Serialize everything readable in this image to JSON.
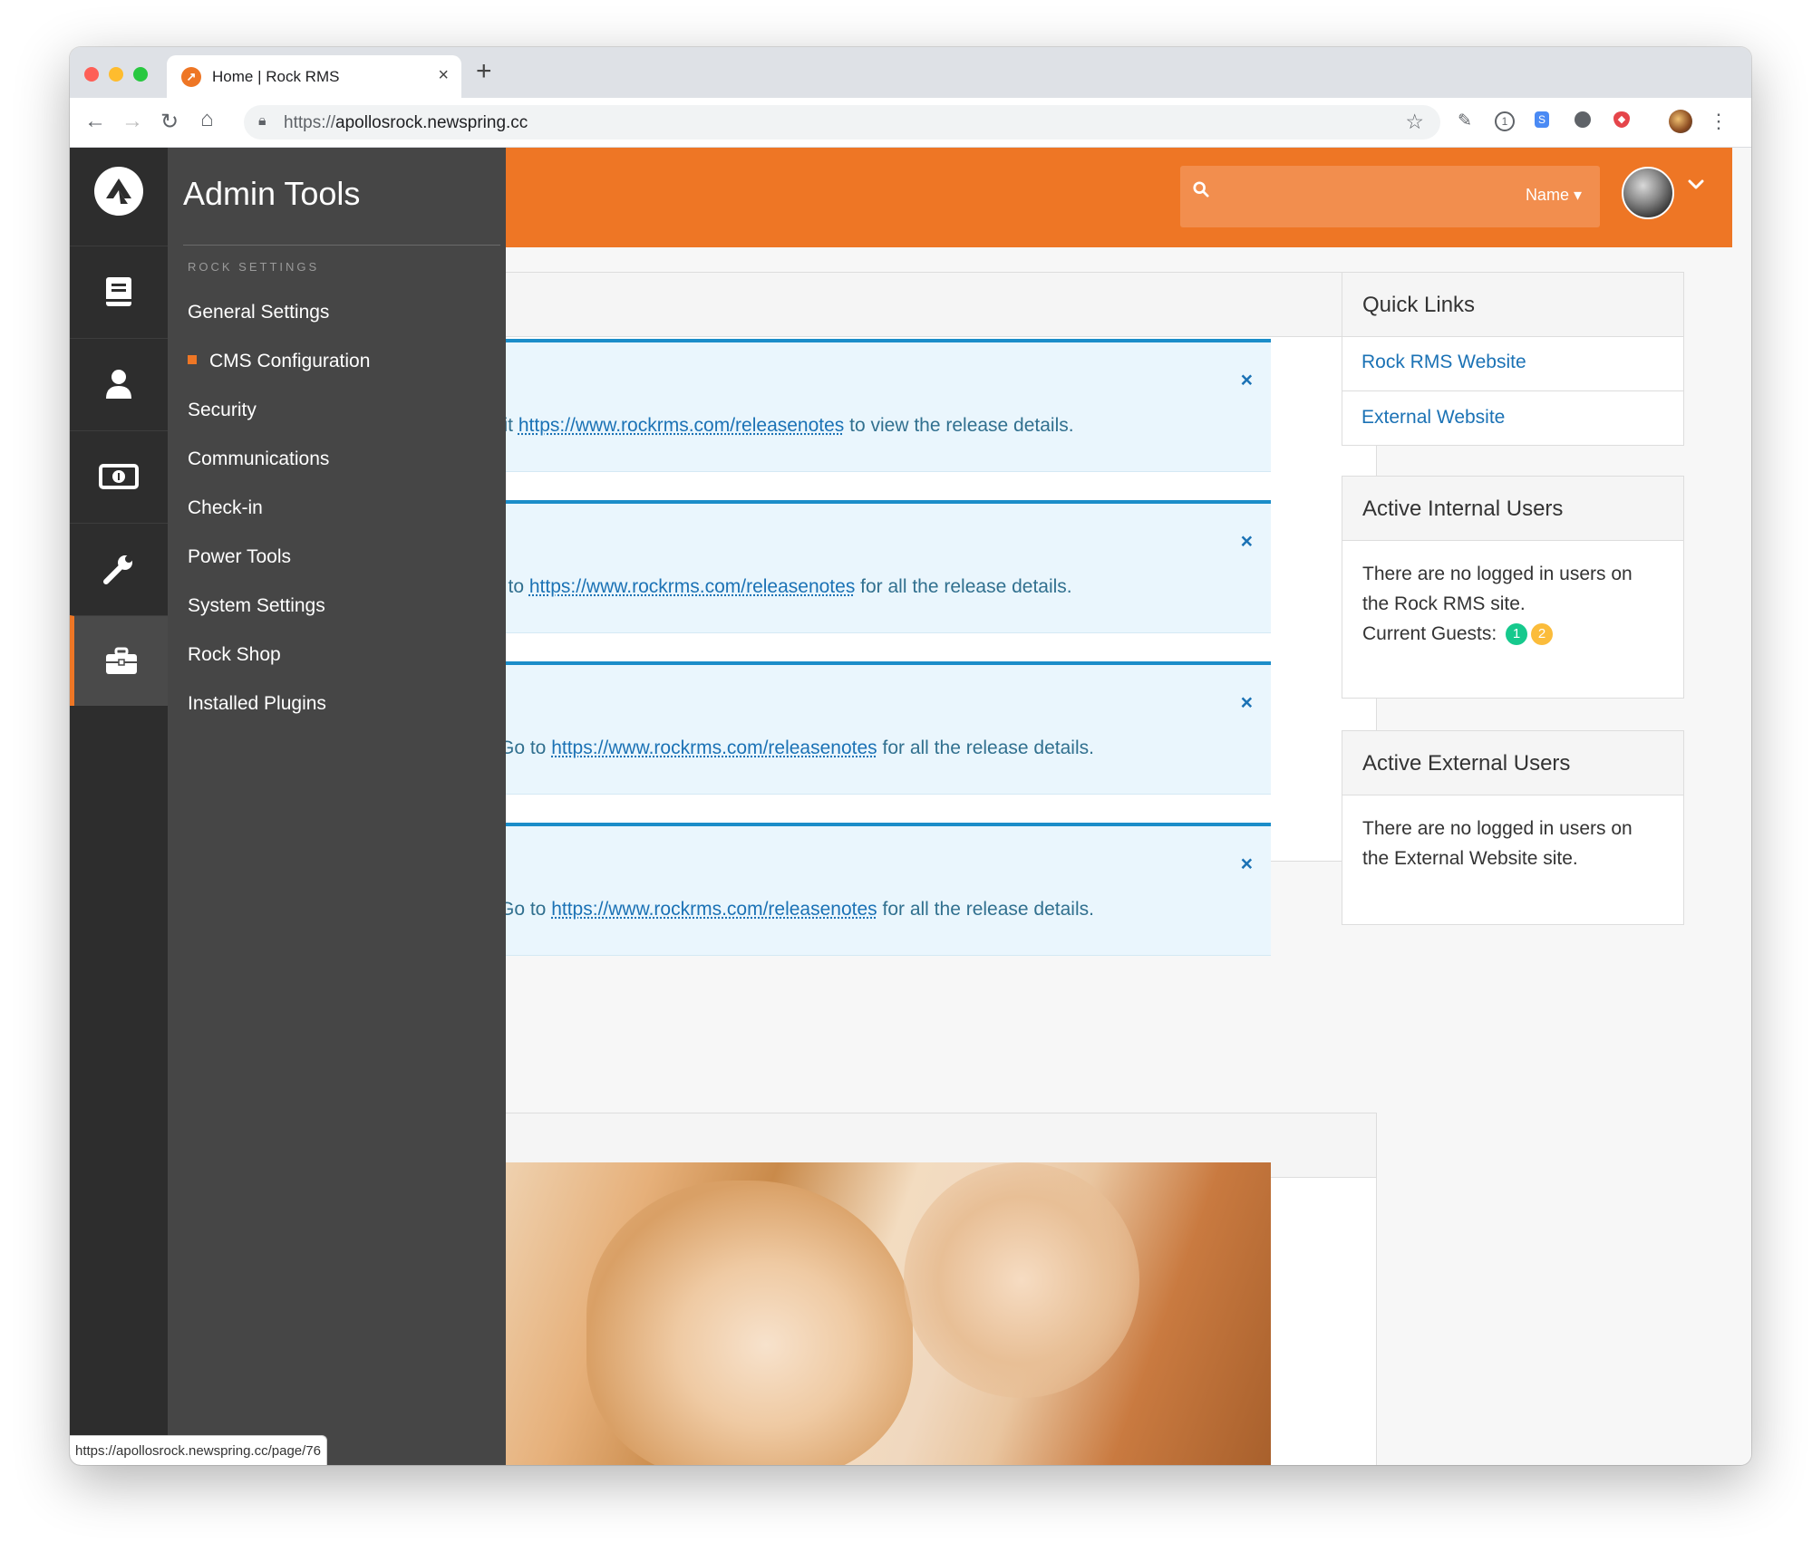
{
  "browser": {
    "tab_title": "Home | Rock RMS",
    "tab_favicon": "rock-logo-icon",
    "url_scheme": "https://",
    "url_host": "apollosrock.newspring.cc",
    "status_url": "https://apollosrock.newspring.cc/page/76"
  },
  "header": {
    "search_placeholder": "",
    "search_type_label": "Name",
    "brand_color": "#ee7625"
  },
  "sidebar": {
    "icons": [
      "book-icon",
      "person-icon",
      "money-icon",
      "wrench-icon",
      "briefcase-icon"
    ],
    "active_icon": "briefcase-icon",
    "flyout_title": "Admin Tools",
    "section_label": "ROCK SETTINGS",
    "items": [
      {
        "label": "General Settings",
        "active": false
      },
      {
        "label": "CMS Configuration",
        "active": true
      },
      {
        "label": "Security",
        "active": false
      },
      {
        "label": "Communications",
        "active": false
      },
      {
        "label": "Check-in",
        "active": false
      },
      {
        "label": "Power Tools",
        "active": false
      },
      {
        "label": "System Settings",
        "active": false
      },
      {
        "label": "Rock Shop",
        "active": false
      },
      {
        "label": "Installed Plugins",
        "active": false
      }
    ]
  },
  "alerts": [
    {
      "prefix": "sit ",
      "link": "https://www.rockrms.com/releasenotes",
      "suffix": " to view the release details.",
      "close": "×"
    },
    {
      "prefix": "» to ",
      "link": "https://www.rockrms.com/releasenotes",
      "suffix": " for all the release details.",
      "close": "×"
    },
    {
      "prefix": "Go to ",
      "link": "https://www.rockrms.com/releasenotes",
      "suffix": " for all the release details.",
      "close": "×"
    },
    {
      "prefix": "Go to ",
      "link": "https://www.rockrms.com/releasenotes",
      "suffix": " for all the release details.",
      "close": "×"
    }
  ],
  "quick_links": {
    "title": "Quick Links",
    "links": [
      "Rock RMS Website",
      "External Website"
    ]
  },
  "active_internal": {
    "title": "Active Internal Users",
    "message_line1": "There are no logged in users on",
    "message_line2": "the Rock RMS site.",
    "guests_label": "Current Guests:",
    "badge1": "1",
    "badge2": "2",
    "badge1_color": "#16c98d",
    "badge2_color": "#fbbc3b"
  },
  "active_external": {
    "title": "Active External Users",
    "message_line1": "There are no logged in users on",
    "message_line2": "the External Website site."
  }
}
